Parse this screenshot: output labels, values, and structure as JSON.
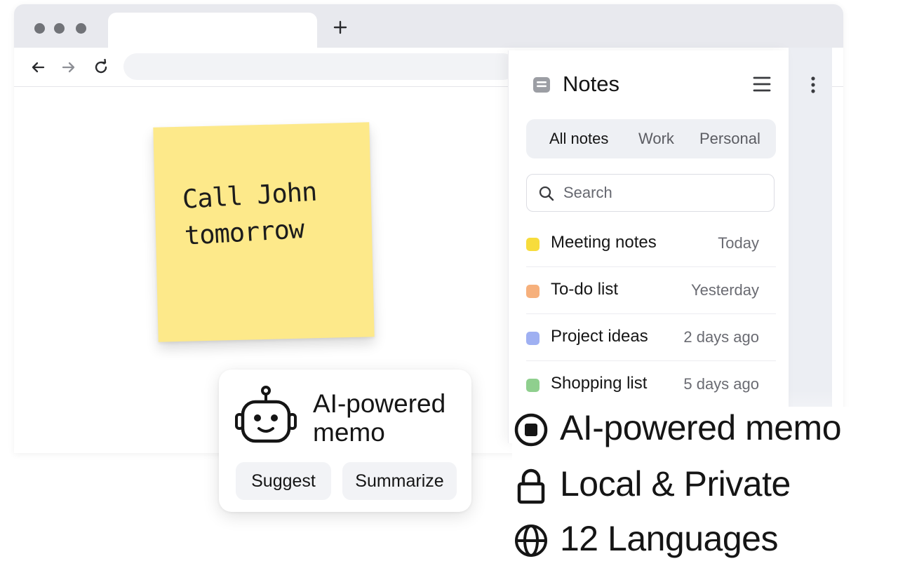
{
  "sticky_note": {
    "text": "Call John\ntomorrow"
  },
  "notes_panel": {
    "title": "Notes",
    "tabs": [
      {
        "label": "All notes",
        "active": true
      },
      {
        "label": "Work",
        "active": false
      },
      {
        "label": "Personal",
        "active": false
      }
    ],
    "search": {
      "placeholder": "Search",
      "value": ""
    },
    "notes": [
      {
        "title": "Meeting notes",
        "date": "Today",
        "color": "#f7dc3c"
      },
      {
        "title": "To-do list",
        "date": "Yesterday",
        "color": "#f6b07c"
      },
      {
        "title": "Project ideas",
        "date": "2 days ago",
        "color": "#9fb0f2"
      },
      {
        "title": "Shopping list",
        "date": "5 days ago",
        "color": "#8fcf8e"
      }
    ]
  },
  "ai_card": {
    "title": "AI-powered\nmemo",
    "buttons": {
      "suggest": "Suggest",
      "summarize": "Summarize"
    }
  },
  "features": [
    {
      "icon": "ai-chip-icon",
      "label": "AI-powered memo"
    },
    {
      "icon": "lock-icon",
      "label": "Local & Private"
    },
    {
      "icon": "globe-icon",
      "label": "12 Languages"
    }
  ],
  "colors": {
    "sticky": "#fde98a",
    "tabstrip": "#e8e9ee",
    "text": "#151515"
  }
}
